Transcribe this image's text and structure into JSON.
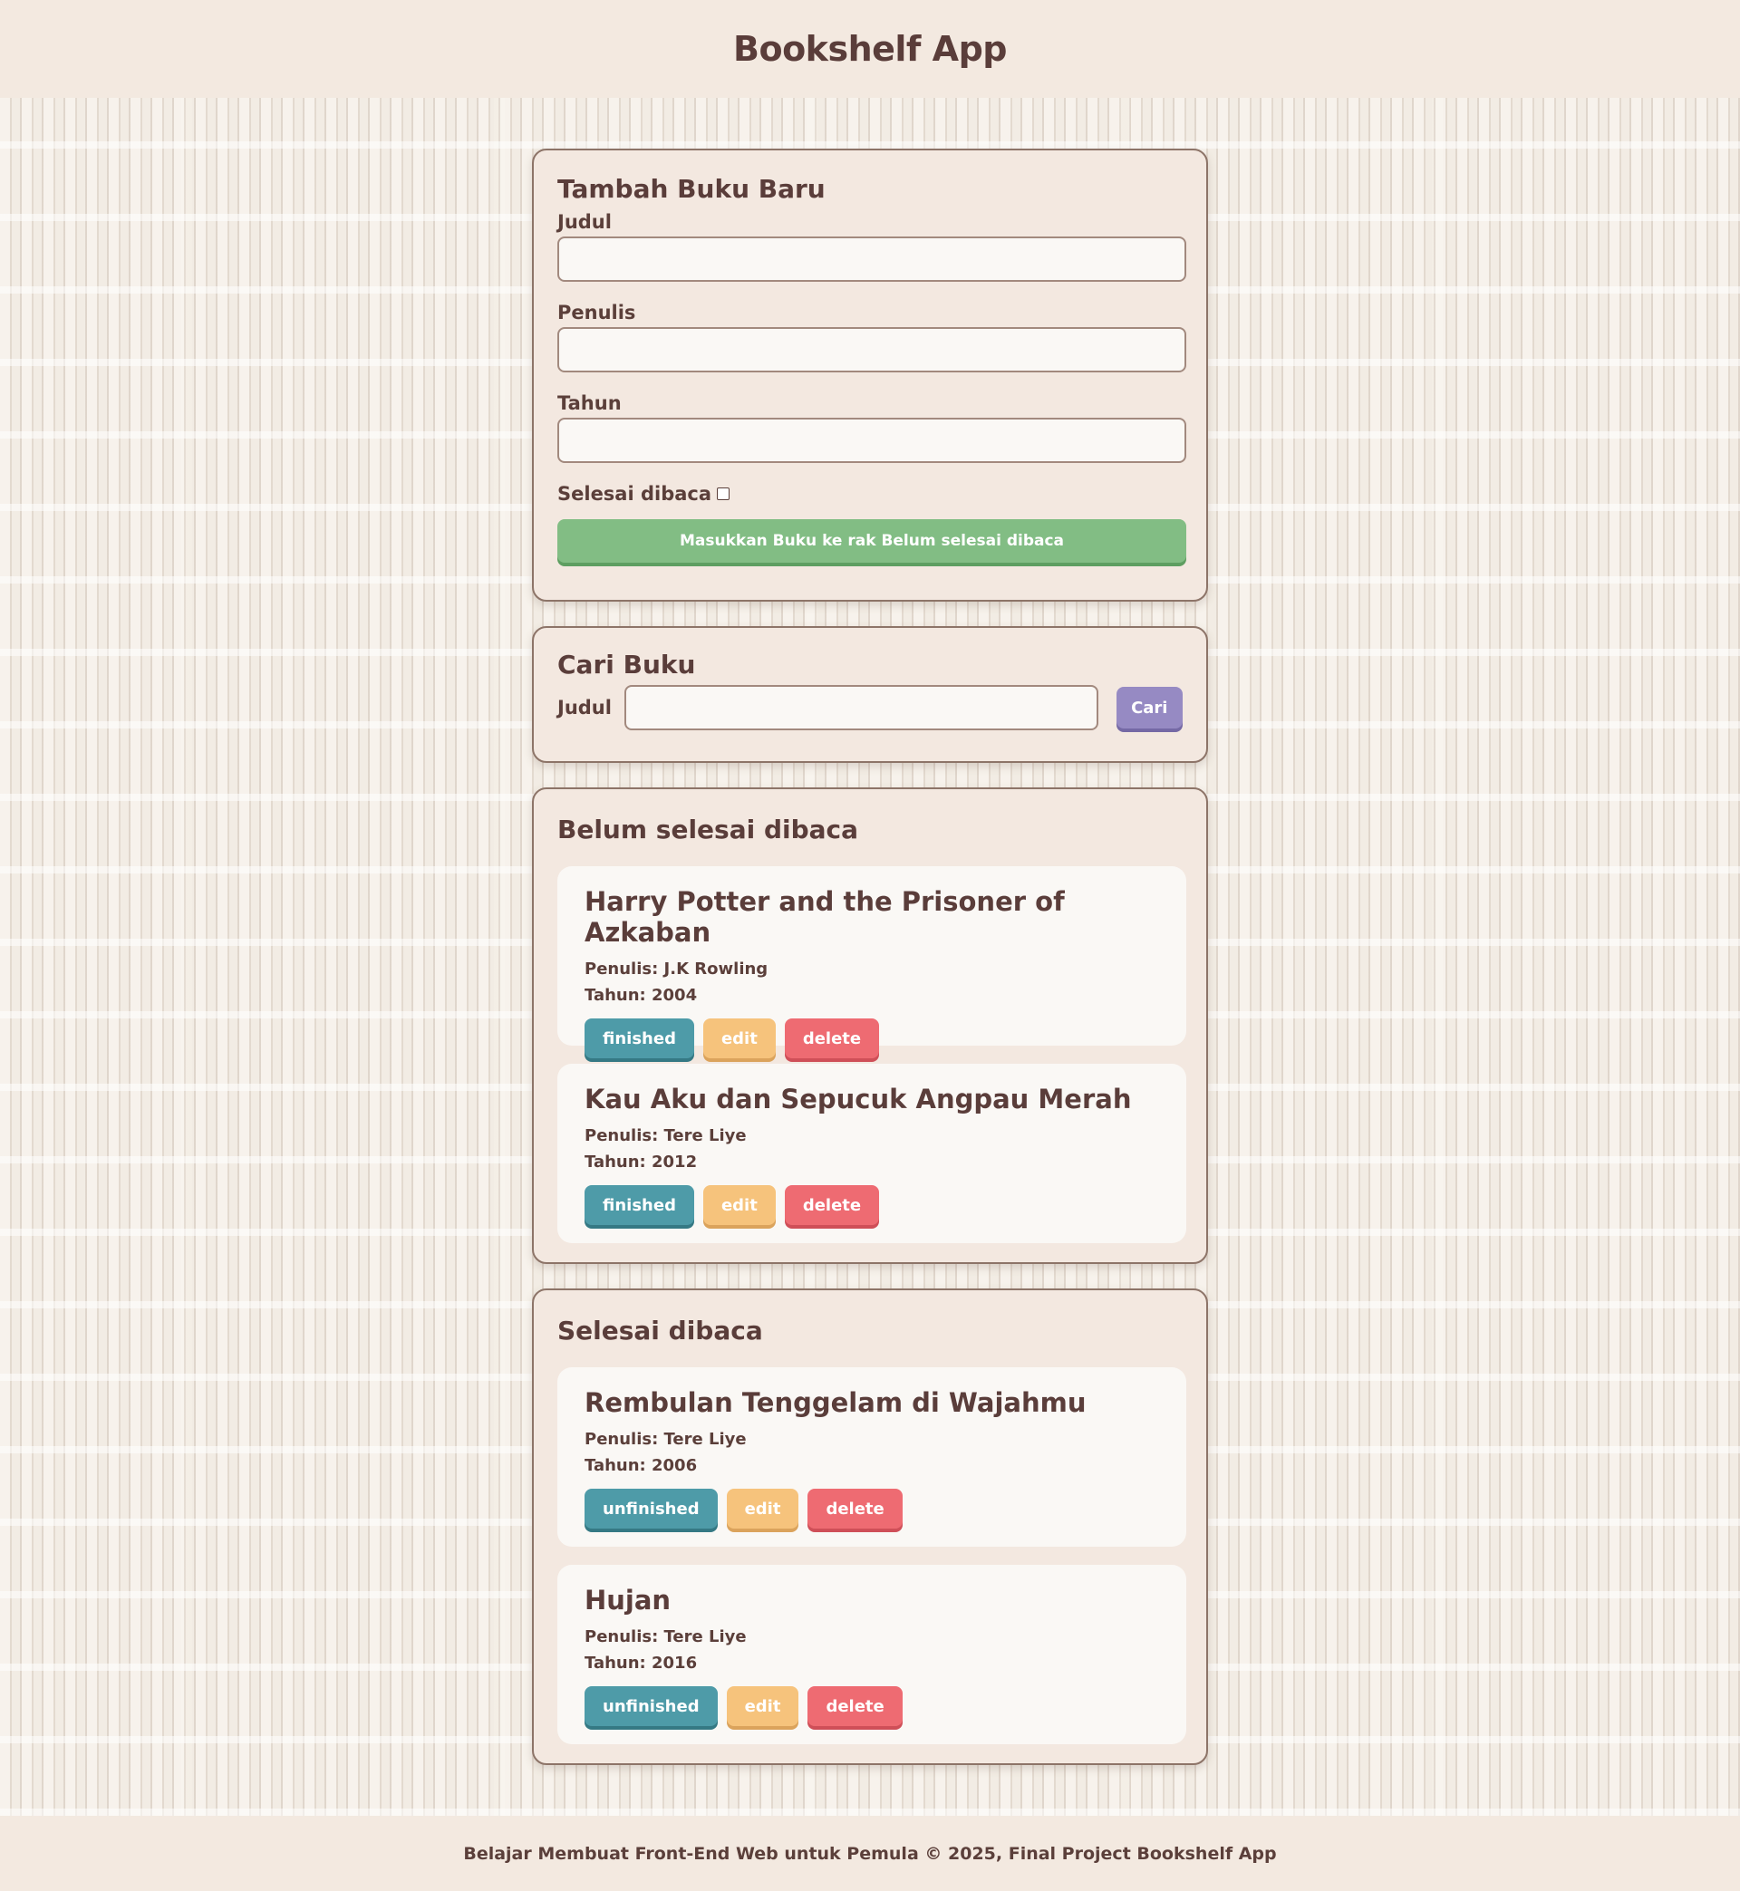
{
  "header": {
    "title": "Bookshelf App"
  },
  "add_form": {
    "heading": "Tambah Buku Baru",
    "title_label": "Judul",
    "title_value": "",
    "author_label": "Penulis",
    "author_value": "",
    "year_label": "Tahun",
    "year_value": "",
    "complete_label": "Selesai dibaca",
    "complete_checked": false,
    "submit_label": "Masukkan Buku ke rak Belum selesai dibaca"
  },
  "search": {
    "heading": "Cari Buku",
    "label": "Judul",
    "value": "",
    "button_label": "Cari"
  },
  "unfinished": {
    "heading": "Belum selesai dibaca",
    "books": [
      {
        "title": "Harry Potter and the Prisoner of Azkaban",
        "author": "Penulis: J.K Rowling",
        "year": "Tahun: 2004",
        "toggle_label": "finished",
        "edit_label": "edit",
        "delete_label": "delete"
      },
      {
        "title": "Kau Aku dan Sepucuk Angpau Merah",
        "author": "Penulis: Tere Liye",
        "year": "Tahun: 2012",
        "toggle_label": "finished",
        "edit_label": "edit",
        "delete_label": "delete"
      }
    ]
  },
  "finished": {
    "heading": "Selesai dibaca",
    "books": [
      {
        "title": "Rembulan Tenggelam di Wajahmu",
        "author": "Penulis: Tere Liye",
        "year": "Tahun: 2006",
        "toggle_label": "unfinished",
        "edit_label": "edit",
        "delete_label": "delete"
      },
      {
        "title": "Hujan",
        "author": "Penulis: Tere Liye",
        "year": "Tahun: 2016",
        "toggle_label": "unfinished",
        "edit_label": "edit",
        "delete_label": "delete"
      }
    ]
  },
  "footer": {
    "text": "Belajar Membuat Front-End Web untuk Pemula © 2025, Final Project Bookshelf App"
  },
  "colors": {
    "submit": "#82bd84",
    "search": "#968ac3",
    "toggle": "#4e9ba8",
    "edit": "#f6c37c",
    "delete": "#ee6b72"
  }
}
